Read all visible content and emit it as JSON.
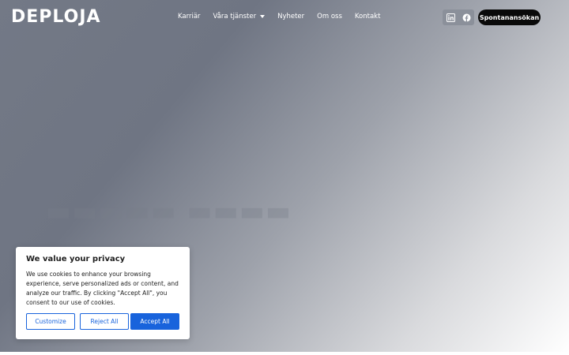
{
  "brand": {
    "logo_text": "DEPLOJA"
  },
  "nav": {
    "items": [
      {
        "label": "Karriär",
        "has_dropdown": false
      },
      {
        "label": "Våra tjänster",
        "has_dropdown": true
      },
      {
        "label": "Nyheter",
        "has_dropdown": false
      },
      {
        "label": "Om oss",
        "has_dropdown": false
      },
      {
        "label": "Kontakt",
        "has_dropdown": false
      }
    ]
  },
  "social": {
    "icons": [
      "linkedin-icon",
      "facebook-icon"
    ]
  },
  "cta": {
    "label": "Spontanansökan"
  },
  "hero": {
    "background_colors": [
      "#737986",
      "#ffffff"
    ]
  },
  "cookie_banner": {
    "title": "We value your privacy",
    "text": "We use cookies to enhance your browsing experience, serve personalized ads or content, and analyze our traffic. By clicking \"Accept All\", you consent to our use of cookies.",
    "buttons": {
      "customize": "Customize",
      "reject": "Reject All",
      "accept": "Accept All"
    },
    "accent_color": "#1863dc"
  }
}
